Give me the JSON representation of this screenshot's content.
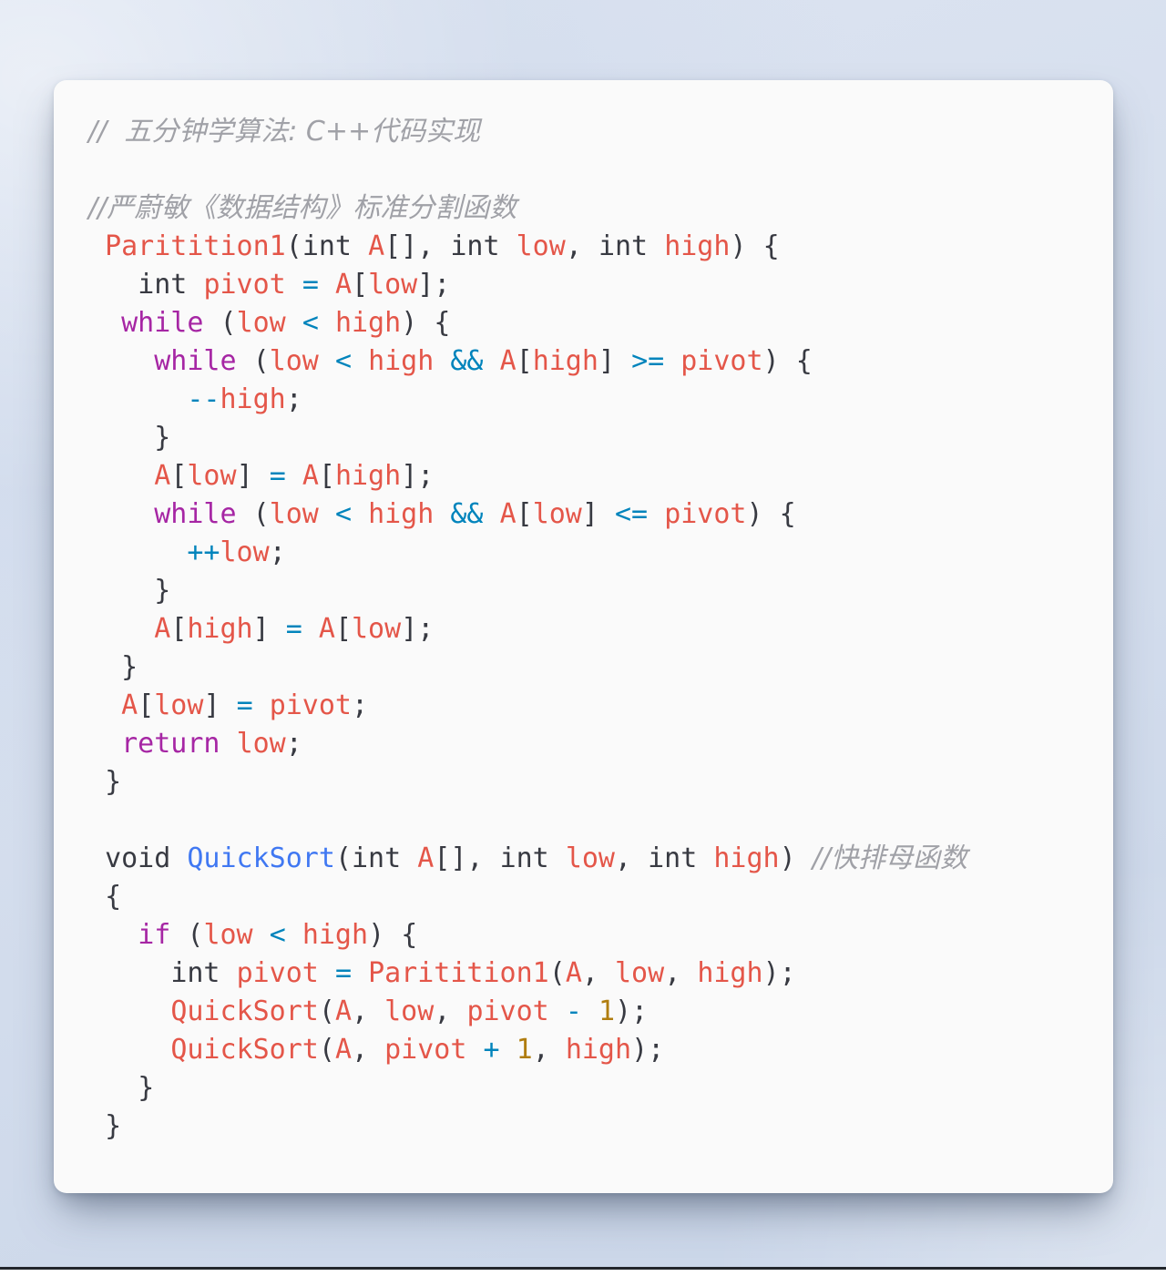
{
  "meta": {
    "background_color": "#d6dfee",
    "card_color": "#fafafa",
    "language": "C++"
  },
  "palette": {
    "comment": "#a0a1a7",
    "keyword": "#a626a4",
    "type": "#383a42",
    "identifier": "#e45649",
    "function_blue": "#4078f2",
    "operator": "#0184bc",
    "number": "#b07d10",
    "punctuation": "#383a42"
  },
  "code": {
    "title_comment": "//  五分钟学算法: C++代码实现",
    "section_comment": "//严蔚敏《数据结构》标准分割函数",
    "trailing_comment": "//快排母函数",
    "lines": [
      {
        "id": "l01",
        "kind": "comment-title",
        "text": "//  五分钟学算法: C++代码实现"
      },
      {
        "id": "l02",
        "kind": "blank",
        "text": ""
      },
      {
        "id": "l03",
        "kind": "comment",
        "text": "//严蔚敏《数据结构》标准分割函数"
      },
      {
        "id": "l04",
        "kind": "code",
        "text": " Paritition1(int A[], int low, int high) {"
      },
      {
        "id": "l05",
        "kind": "code",
        "text": "   int pivot = A[low];"
      },
      {
        "id": "l06",
        "kind": "code",
        "text": "  while (low < high) {"
      },
      {
        "id": "l07",
        "kind": "code",
        "text": "    while (low < high && A[high] >= pivot) {"
      },
      {
        "id": "l08",
        "kind": "code",
        "text": "      --high;"
      },
      {
        "id": "l09",
        "kind": "code",
        "text": "    }"
      },
      {
        "id": "l10",
        "kind": "code",
        "text": "    A[low] = A[high];"
      },
      {
        "id": "l11",
        "kind": "code",
        "text": "    while (low < high && A[low] <= pivot) {"
      },
      {
        "id": "l12",
        "kind": "code",
        "text": "      ++low;"
      },
      {
        "id": "l13",
        "kind": "code",
        "text": "    }"
      },
      {
        "id": "l14",
        "kind": "code",
        "text": "    A[high] = A[low];"
      },
      {
        "id": "l15",
        "kind": "code",
        "text": "  }"
      },
      {
        "id": "l16",
        "kind": "code",
        "text": "  A[low] = pivot;"
      },
      {
        "id": "l17",
        "kind": "code",
        "text": "  return low;"
      },
      {
        "id": "l18",
        "kind": "code",
        "text": " }"
      },
      {
        "id": "l19",
        "kind": "blank",
        "text": ""
      },
      {
        "id": "l20",
        "kind": "code",
        "text": " void QuickSort(int A[], int low, int high) //快排母函数"
      },
      {
        "id": "l21",
        "kind": "code",
        "text": " {"
      },
      {
        "id": "l22",
        "kind": "code",
        "text": "   if (low < high) {"
      },
      {
        "id": "l23",
        "kind": "code",
        "text": "     int pivot = Paritition1(A, low, high);"
      },
      {
        "id": "l24",
        "kind": "code",
        "text": "     QuickSort(A, low, pivot - 1);"
      },
      {
        "id": "l25",
        "kind": "code",
        "text": "     QuickSort(A, pivot + 1, high);"
      },
      {
        "id": "l26",
        "kind": "code",
        "text": "   }"
      },
      {
        "id": "l27",
        "kind": "code",
        "text": " }"
      }
    ],
    "tokens": {
      "keywords": [
        "while",
        "return",
        "if"
      ],
      "types": [
        "int",
        "void"
      ],
      "identifiers": [
        "Paritition1",
        "QuickSort",
        "A",
        "low",
        "high",
        "pivot"
      ],
      "operators": [
        "=",
        "<",
        ">=",
        "<=",
        "&&",
        "--",
        "++",
        "-",
        "+"
      ],
      "numbers": [
        "1"
      ]
    }
  }
}
